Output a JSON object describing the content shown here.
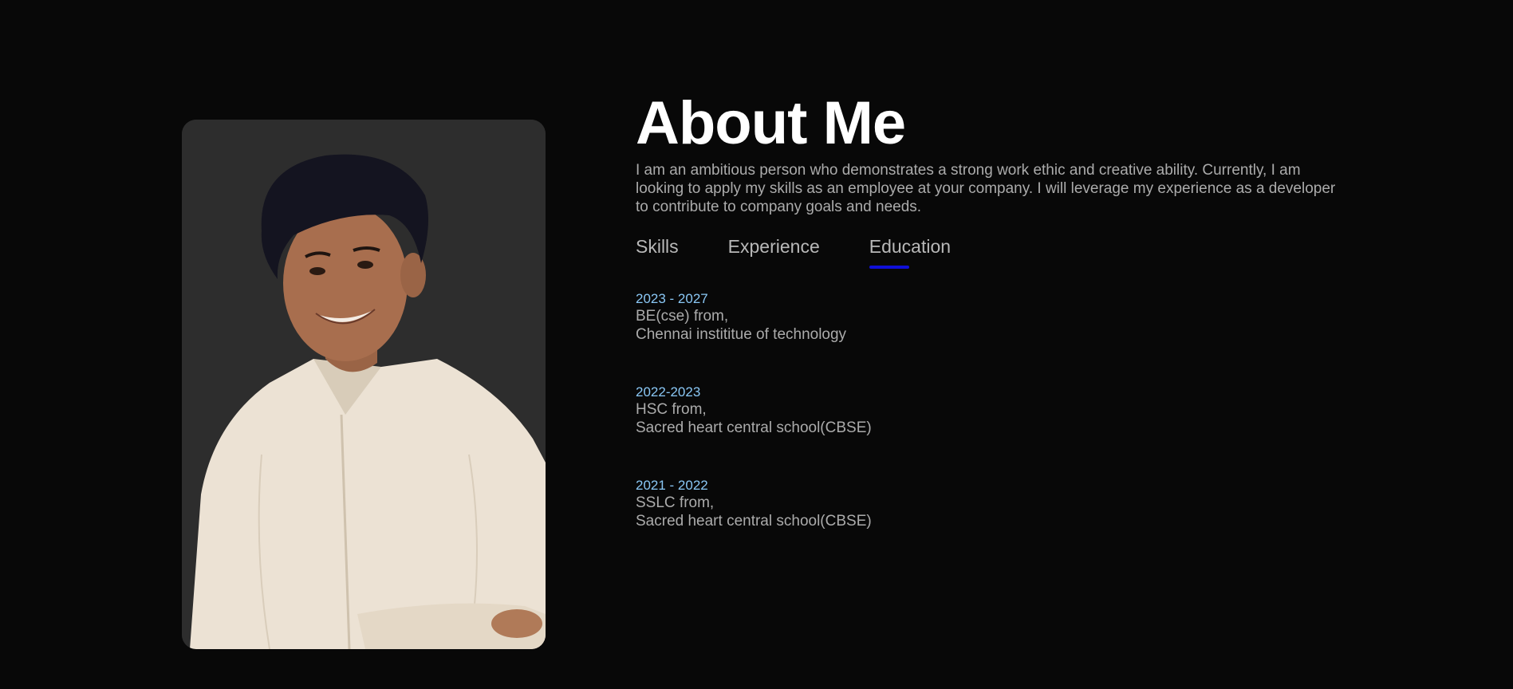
{
  "about": {
    "title": "About Me",
    "intro": "I am an ambitious person who demonstrates a strong work ethic and creative ability. Currently, I am looking to apply my skills as an employee at your company. I will leverage my experience as a developer to contribute to company goals and needs."
  },
  "tabs": [
    {
      "label": "Skills",
      "active": false
    },
    {
      "label": "Experience",
      "active": false
    },
    {
      "label": "Education",
      "active": true
    }
  ],
  "education": [
    {
      "years": "2023 - 2027",
      "degree": "BE(cse) from,",
      "institution": "Chennai instititue of technology"
    },
    {
      "years": "2022-2023",
      "degree": "HSC from,",
      "institution": "Sacred heart central school(CBSE)"
    },
    {
      "years": "2021 - 2022",
      "degree": "SSLC from,",
      "institution": "Sacred heart central school(CBSE)"
    }
  ],
  "colors": {
    "background": "#080808",
    "photo_bg": "#2d2d2d",
    "tab_underline": "#1010d8",
    "year_text": "#8ac7f5"
  }
}
